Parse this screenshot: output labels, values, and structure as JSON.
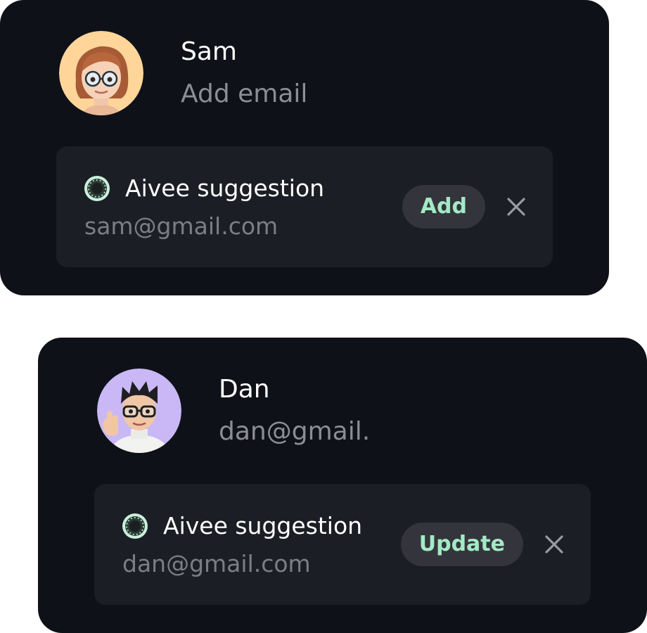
{
  "cards": [
    {
      "name": "Sam",
      "email": "Add email",
      "avatar_icon": "memoji-avatar-sam",
      "avatar_bg": "#ffd59a",
      "suggestion": {
        "label": "Aivee suggestion",
        "value": "sam@gmail.com",
        "action_label": "Add",
        "dismiss_icon": "close-icon",
        "ai_icon": "aivee-ai-icon"
      }
    },
    {
      "name": "Dan",
      "email": "dan@gmail.",
      "avatar_icon": "memoji-avatar-dan",
      "avatar_bg": "#c9b8f5",
      "suggestion": {
        "label": "Aivee suggestion",
        "value": "dan@gmail.com",
        "action_label": "Update",
        "dismiss_icon": "close-icon",
        "ai_icon": "aivee-ai-icon"
      }
    }
  ],
  "colors": {
    "card_bg": "#0f1118",
    "suggestion_bg": "#1c1e25",
    "accent_text": "#a4e9c5",
    "button_bg": "#34353c",
    "muted_text": "#8d8e93"
  }
}
